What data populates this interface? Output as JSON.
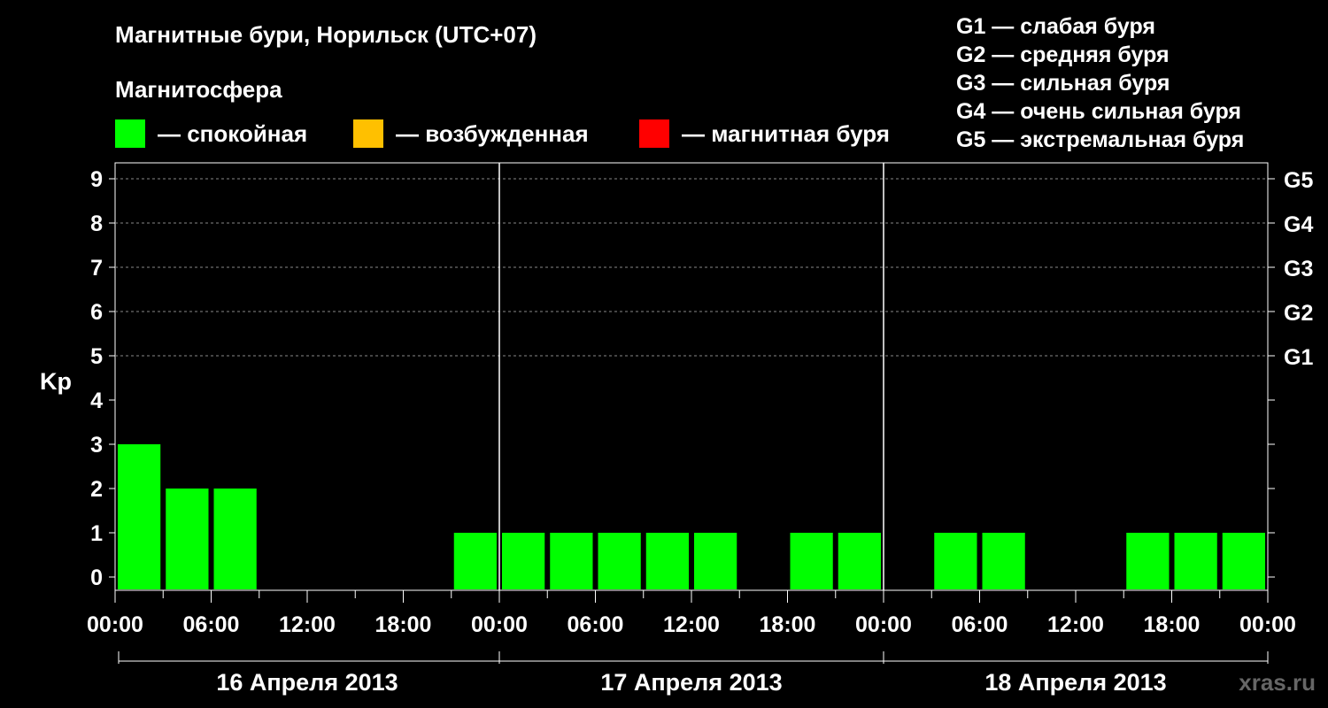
{
  "title": "Магнитные бури, Норильск (UTC+07)",
  "subtitle": "Магнитосфера",
  "legend": [
    {
      "color": "#00ff00",
      "label": "— спокойная"
    },
    {
      "color": "#ffc000",
      "label": "— возбужденная"
    },
    {
      "color": "#ff0000",
      "label": "— магнитная буря"
    }
  ],
  "storm_levels": [
    "G1 — слабая буря",
    "G2 — средняя буря",
    "G3 — сильная буря",
    "G4 — очень сильная буря",
    "G5 — экстремальная буря"
  ],
  "watermark": "xras.ru",
  "chart_data": {
    "type": "bar",
    "ylabel": "Kp",
    "ylim": [
      0,
      9
    ],
    "yticks": [
      "0",
      "1",
      "2",
      "3",
      "4",
      "5",
      "6",
      "7",
      "8",
      "9"
    ],
    "right_ticks": [
      {
        "kp": 5,
        "label": "G1"
      },
      {
        "kp": 6,
        "label": "G2"
      },
      {
        "kp": 7,
        "label": "G3"
      },
      {
        "kp": 8,
        "label": "G4"
      },
      {
        "kp": 9,
        "label": "G5"
      }
    ],
    "xtick_labels": [
      "00:00",
      "06:00",
      "12:00",
      "18:00",
      "00:00",
      "06:00",
      "12:00",
      "18:00",
      "00:00",
      "06:00",
      "12:00",
      "18:00",
      "00:00"
    ],
    "days": [
      "16 Апреля 2013",
      "17 Апреля 2013",
      "18 Апреля 2013"
    ],
    "interval_hours": 3,
    "grid": true,
    "bars": [
      {
        "day": 0,
        "start_hour": 0,
        "kp": 3,
        "color": "#00ff00"
      },
      {
        "day": 0,
        "start_hour": 3,
        "kp": 2,
        "color": "#00ff00"
      },
      {
        "day": 0,
        "start_hour": 6,
        "kp": 2,
        "color": "#00ff00"
      },
      {
        "day": 0,
        "start_hour": 21,
        "kp": 1,
        "color": "#00ff00"
      },
      {
        "day": 1,
        "start_hour": 0,
        "kp": 1,
        "color": "#00ff00"
      },
      {
        "day": 1,
        "start_hour": 3,
        "kp": 1,
        "color": "#00ff00"
      },
      {
        "day": 1,
        "start_hour": 6,
        "kp": 1,
        "color": "#00ff00"
      },
      {
        "day": 1,
        "start_hour": 9,
        "kp": 1,
        "color": "#00ff00"
      },
      {
        "day": 1,
        "start_hour": 12,
        "kp": 1,
        "color": "#00ff00"
      },
      {
        "day": 1,
        "start_hour": 18,
        "kp": 1,
        "color": "#00ff00"
      },
      {
        "day": 1,
        "start_hour": 21,
        "kp": 1,
        "color": "#00ff00"
      },
      {
        "day": 2,
        "start_hour": 3,
        "kp": 1,
        "color": "#00ff00"
      },
      {
        "day": 2,
        "start_hour": 6,
        "kp": 1,
        "color": "#00ff00"
      },
      {
        "day": 2,
        "start_hour": 15,
        "kp": 1,
        "color": "#00ff00"
      },
      {
        "day": 2,
        "start_hour": 18,
        "kp": 1,
        "color": "#00ff00"
      },
      {
        "day": 2,
        "start_hour": 21,
        "kp": 1,
        "color": "#00ff00"
      }
    ]
  }
}
